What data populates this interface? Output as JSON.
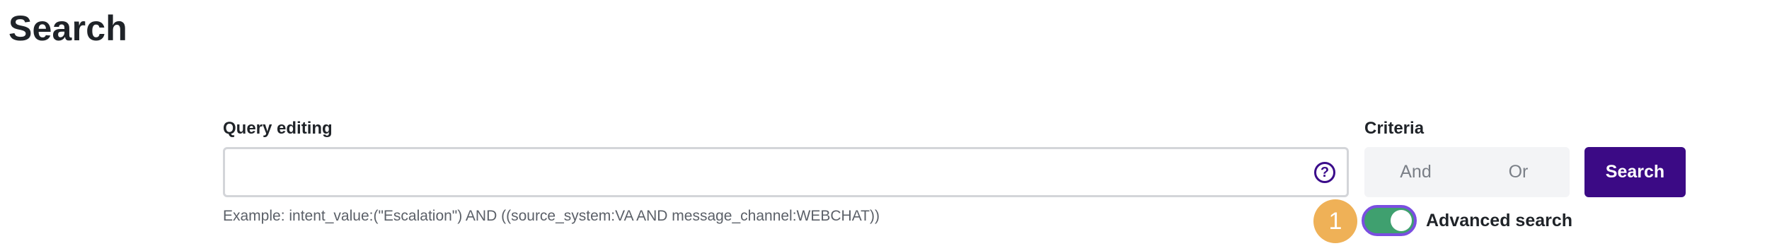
{
  "page": {
    "title": "Search"
  },
  "query": {
    "label": "Query editing",
    "value": "",
    "help_icon": "question-circle-icon",
    "example": "Example: intent_value:(\"Escalation\") AND ((source_system:VA AND message_channel:WEBCHAT))"
  },
  "criteria": {
    "label": "Criteria",
    "options": [
      "And",
      "Or"
    ]
  },
  "search_button": {
    "label": "Search"
  },
  "annotation": {
    "step_number": "1"
  },
  "advanced_search": {
    "label": "Advanced search",
    "enabled": true
  },
  "colors": {
    "primary": "#3b0a85",
    "toggle_on": "#3fa06f",
    "toggle_border": "#7a4ee0",
    "badge": "#efb157"
  }
}
